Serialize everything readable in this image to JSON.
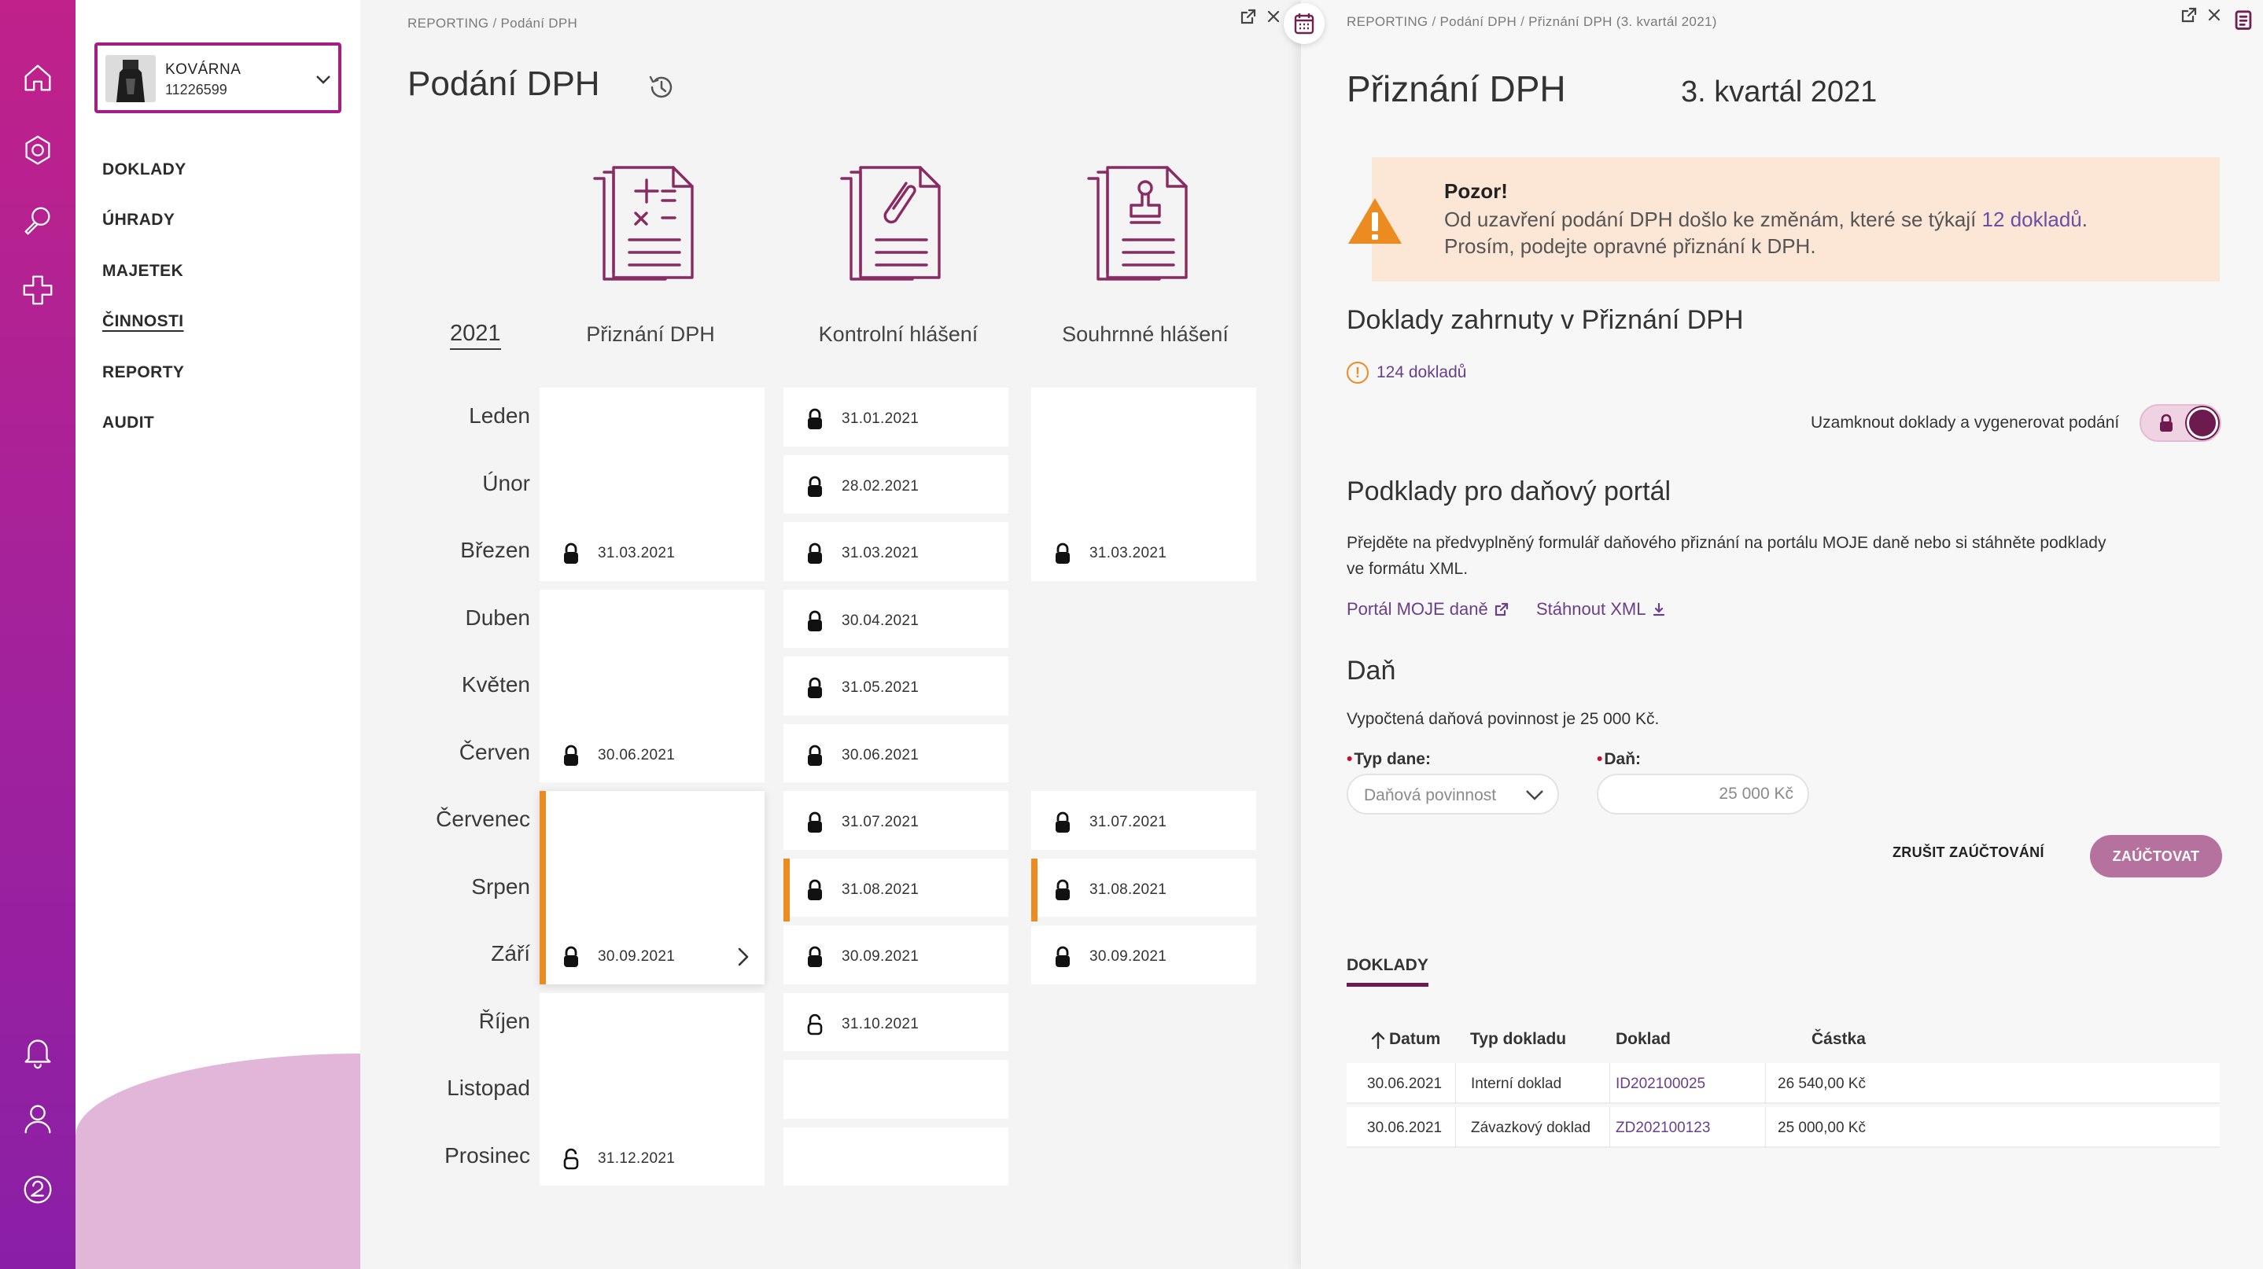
{
  "rail": {
    "icons": [
      "home-icon",
      "hexagon-icon",
      "search-icon",
      "cross-icon",
      "bell-icon",
      "user-icon",
      "help-icon"
    ]
  },
  "company": {
    "name": "KOVÁRNA",
    "id": "11226599"
  },
  "menu": [
    {
      "label": "DOKLADY"
    },
    {
      "label": "ÚHRADY"
    },
    {
      "label": "MAJETEK"
    },
    {
      "label": "ČINNOSTI",
      "active": true
    },
    {
      "label": "REPORTY"
    },
    {
      "label": "AUDIT"
    }
  ],
  "middle": {
    "breadcrumb": [
      "REPORTING",
      "Podání DPH"
    ],
    "title": "Podání DPH",
    "year": "2021",
    "columns": [
      "Přiznání DPH",
      "Kontrolní hlášení",
      "Souhrnné hlášení"
    ],
    "months": [
      "Leden",
      "Únor",
      "Březen",
      "Duben",
      "Květen",
      "Červen",
      "Červenec",
      "Srpen",
      "Září",
      "Říjen",
      "Listopad",
      "Prosinec"
    ],
    "priznani": [
      {
        "row": 2,
        "date": "31.03.2021",
        "locked": true
      },
      {
        "row": 5,
        "date": "30.06.2021",
        "locked": true
      },
      {
        "row": 8,
        "date": "30.09.2021",
        "locked": true
      },
      {
        "row": 11,
        "date": "31.12.2021",
        "locked": false
      }
    ],
    "kontrolni": [
      {
        "row": 0,
        "date": "31.01.2021",
        "locked": true
      },
      {
        "row": 1,
        "date": "28.02.2021",
        "locked": true
      },
      {
        "row": 2,
        "date": "31.03.2021",
        "locked": true
      },
      {
        "row": 3,
        "date": "30.04.2021",
        "locked": true
      },
      {
        "row": 4,
        "date": "31.05.2021",
        "locked": true
      },
      {
        "row": 5,
        "date": "30.06.2021",
        "locked": true
      },
      {
        "row": 6,
        "date": "31.07.2021",
        "locked": true
      },
      {
        "row": 7,
        "date": "31.08.2021",
        "locked": true,
        "accent": true
      },
      {
        "row": 8,
        "date": "30.09.2021",
        "locked": true
      },
      {
        "row": 9,
        "date": "31.10.2021",
        "locked": false
      }
    ],
    "souhrnne": [
      {
        "row": 2,
        "date": "31.03.2021",
        "locked": true
      },
      {
        "row": 6,
        "date": "31.07.2021",
        "locked": true
      },
      {
        "row": 7,
        "date": "31.08.2021",
        "locked": true,
        "accent": true
      },
      {
        "row": 8,
        "date": "30.09.2021",
        "locked": true
      }
    ]
  },
  "right": {
    "breadcrumb": [
      "REPORTING",
      "Podání DPH",
      "Přiznání DPH (3. kvartál 2021)"
    ],
    "title": "Přiznání DPH",
    "quarter": "3. kvartál 2021",
    "warning": {
      "title": "Pozor!",
      "line1_prefix": "Od uzavření podání DPH došlo ke změnám, které se týkají ",
      "line1_link": "12 dokladů",
      "line1_suffix": ".",
      "line2": "Prosím, podejte opravné přiznání k DPH."
    },
    "section_included": "Doklady zahrnuty v Přiznání DPH",
    "count_link": "124 dokladů",
    "lock_toggle_label": "Uzamknout doklady a vygenerovat podání",
    "section_portal": "Podklady pro daňový portál",
    "portal_text_1": "Přejděte na předvyplněný formulář daňového přiznání na portálu MOJE daně nebo si stáhněte podklady",
    "portal_text_2": "ve formátu XML.",
    "portal_link": "Portál MOJE daně",
    "xml_link": "Stáhnout XML",
    "section_tax": "Daň",
    "tax_text": "Vypočtená daňová povinnost je 25 000 Kč.",
    "field_type_label": "Typ dane:",
    "field_type_value": "Daňová povinnost",
    "field_tax_label": "Daň:",
    "field_tax_value": "25 000 Kč",
    "btn_cancel": "ZRUŠIT ZAÚČTOVÁNÍ",
    "btn_post": "ZAÚČTOVAT",
    "tab": "DOKLADY",
    "table": {
      "headers": [
        "Datum",
        "Typ dokladu",
        "Doklad",
        "Částka"
      ],
      "rows": [
        {
          "date": "30.06.2021",
          "type": "Interní doklad",
          "doc": "ID202100025",
          "amount": "26 540,00 Kč"
        },
        {
          "date": "30.06.2021",
          "type": "Závazkový doklad",
          "doc": "ZD202100123",
          "amount": "25 000,00 Kč"
        }
      ]
    }
  },
  "colors": {
    "accent_orange": "#ec8b1f",
    "brand_plum": "#8a2a62",
    "rail_top": "#c0218a",
    "rail_bottom": "#8a1fa6"
  }
}
